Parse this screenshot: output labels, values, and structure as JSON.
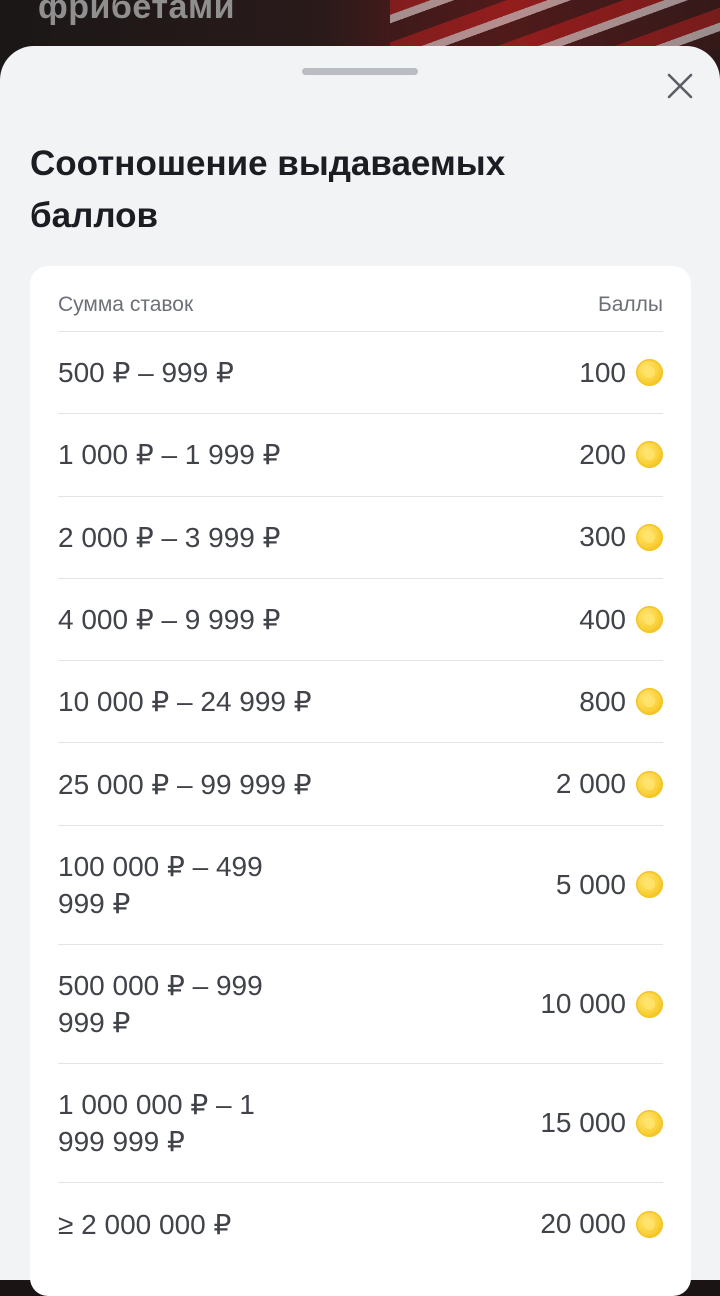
{
  "background": {
    "title": "фрибетами"
  },
  "sheet": {
    "title": "Соотношение выдаваемых баллов",
    "close_icon": "close-icon",
    "table": {
      "headers": {
        "amount": "Сумма ставок",
        "points": "Баллы"
      },
      "rows": [
        {
          "range": "500 ₽ – 999 ₽",
          "points": "100"
        },
        {
          "range": "1 000 ₽ – 1 999 ₽",
          "points": "200"
        },
        {
          "range": "2 000 ₽ – 3 999 ₽",
          "points": "300"
        },
        {
          "range": "4 000 ₽ – 9 999 ₽",
          "points": "400"
        },
        {
          "range": "10 000 ₽ – 24 999 ₽",
          "points": "800"
        },
        {
          "range": "25 000 ₽ – 99 999 ₽",
          "points": "2 000"
        },
        {
          "range": "100 000 ₽ – 499 999 ₽",
          "points": "5 000"
        },
        {
          "range": "500 000 ₽ – 999 999 ₽",
          "points": "10 000"
        },
        {
          "range": "1 000 000 ₽ – 1 999 999 ₽",
          "points": "15 000"
        },
        {
          "range": "≥ 2 000 000 ₽",
          "points": "20 000"
        }
      ],
      "coin_icon": "coin-icon",
      "coin_color": "#f9cf34"
    }
  }
}
